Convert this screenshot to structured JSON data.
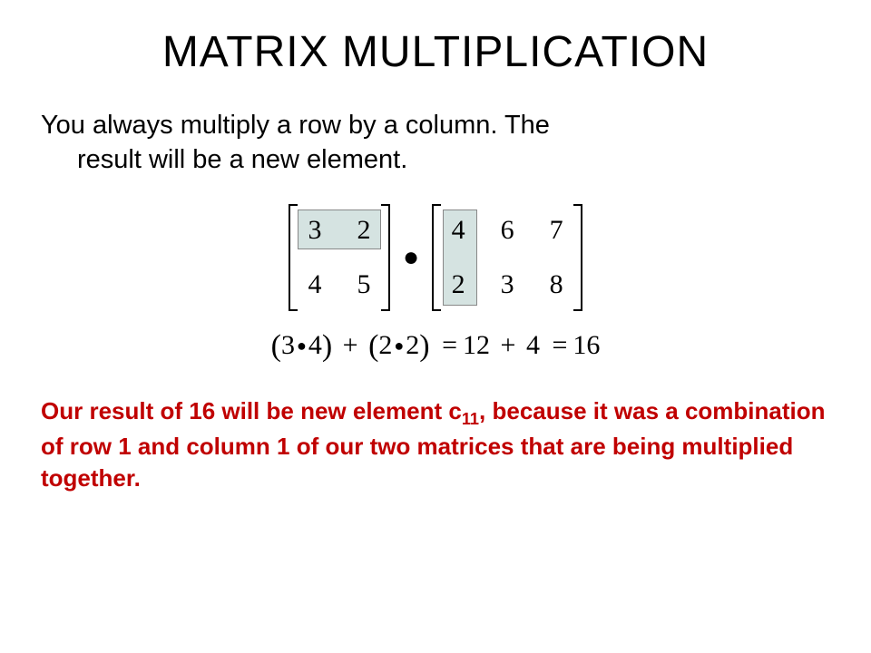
{
  "title": "MATRIX MULTIPLICATION",
  "intro_line1": "You always multiply a row by a column. The",
  "intro_line2": "result will be a new element.",
  "matrixA": {
    "r1c1": "3",
    "r1c2": "2",
    "r2c1": "4",
    "r2c2": "5"
  },
  "matrixB": {
    "r1c1": "4",
    "r1c2": "6",
    "r1c3": "7",
    "r2c1": "2",
    "r2c2": "3",
    "r2c3": "8"
  },
  "dot_symbol": "●",
  "eq": {
    "open1": "(",
    "a1": "3",
    "d1": "●",
    "b1": "4",
    "close1": ")",
    "plus": "+",
    "open2": "(",
    "a2": "2",
    "d2": "●",
    "b2": "2",
    "close2": ")",
    "eq1": "=",
    "sum1": "12",
    "plus2": "+",
    "sum2": "4",
    "eq2": "=",
    "result": "16"
  },
  "conclusion": {
    "part1": "Our result of 16 will be new element c",
    "sub": "11",
    "part2": ", because it was a combination of row 1 and column 1 of our two matrices that are being multiplied together."
  }
}
